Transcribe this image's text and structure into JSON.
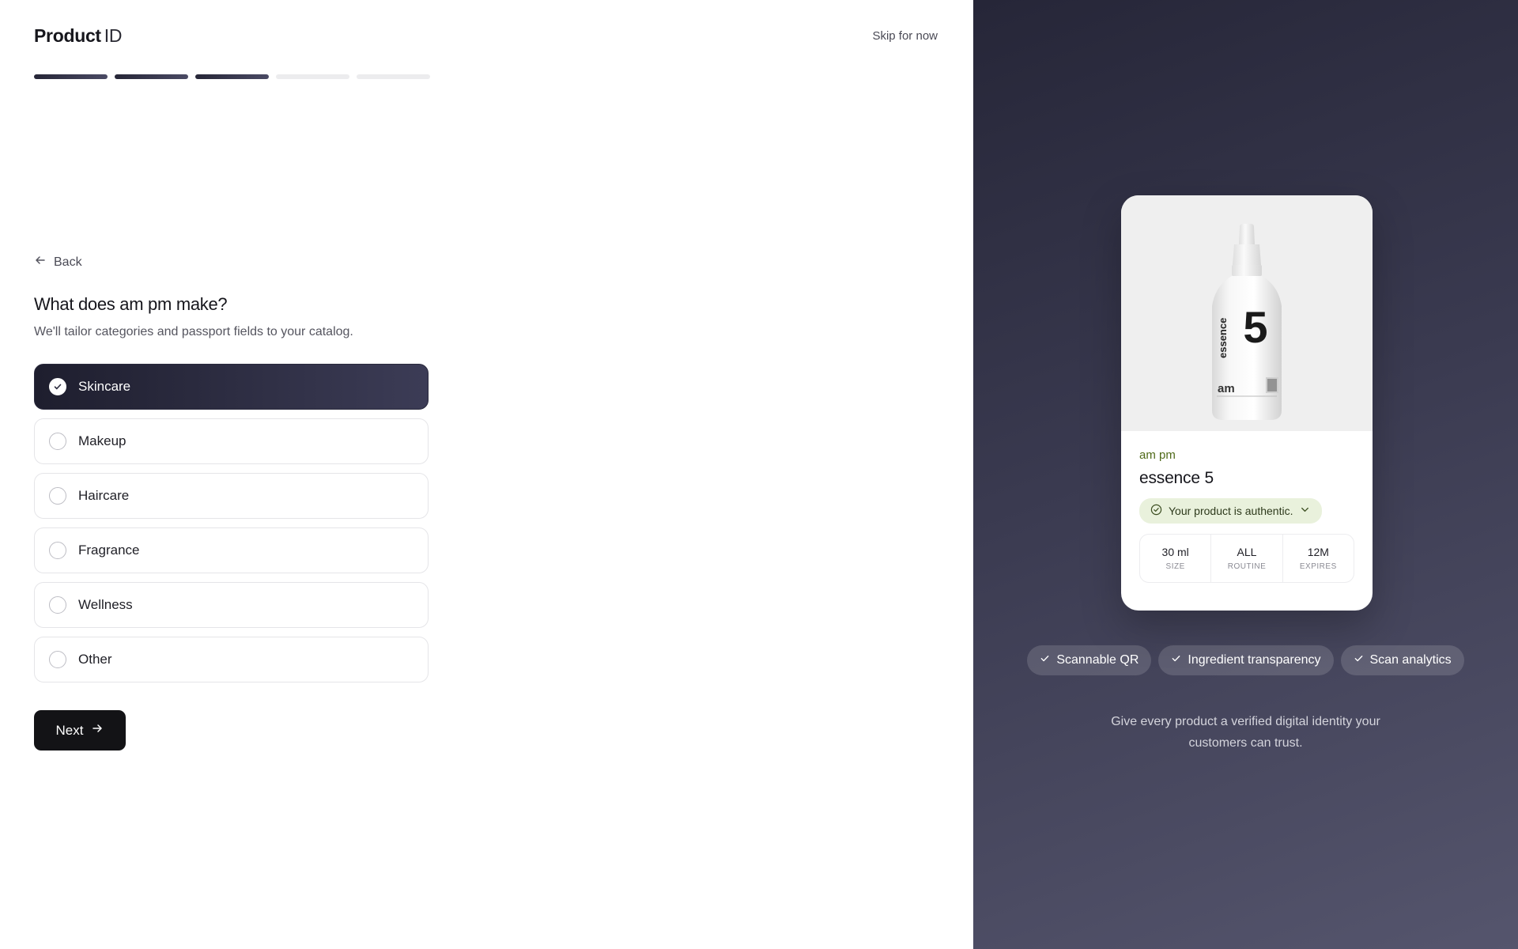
{
  "header": {
    "brand_bold": "Product",
    "brand_light": "ID",
    "skip_label": "Skip for now"
  },
  "progress": {
    "total_steps": 5,
    "completed_steps": 3
  },
  "back_label": "Back",
  "question": {
    "title": "What does am pm make?",
    "subtitle": "We'll tailor categories and passport fields to your catalog."
  },
  "options": [
    {
      "label": "Skincare",
      "selected": true
    },
    {
      "label": "Makeup",
      "selected": false
    },
    {
      "label": "Haircare",
      "selected": false
    },
    {
      "label": "Fragrance",
      "selected": false
    },
    {
      "label": "Wellness",
      "selected": false
    },
    {
      "label": "Other",
      "selected": false
    }
  ],
  "next_label": "Next",
  "preview": {
    "brand": "am pm",
    "product_name": "essence 5",
    "bottle_number": "5",
    "bottle_word": "essence",
    "bottle_brand": "am",
    "auth_text": "Your product is authentic.",
    "specs": [
      {
        "value": "30 ml",
        "label": "SIZE"
      },
      {
        "value": "ALL",
        "label": "ROUTINE"
      },
      {
        "value": "12M",
        "label": "EXPIRES"
      }
    ]
  },
  "features": [
    "Scannable QR",
    "Ingredient transparency",
    "Scan analytics"
  ],
  "tagline": "Give every product a verified digital identity your customers can trust.",
  "colors": {
    "accent_dark": "#1e1e2e",
    "panel_gradient_start": "#262638",
    "panel_gradient_end": "#55556d",
    "auth_badge_bg": "#e9f1dc",
    "brand_green": "#4f6a18"
  }
}
